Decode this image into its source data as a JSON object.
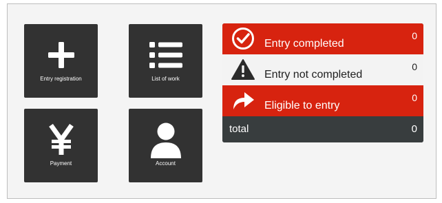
{
  "tiles": {
    "entry_registration": {
      "label": "Entry registration",
      "icon": "plus-icon"
    },
    "list_of_work": {
      "label": "List of work",
      "icon": "list-icon"
    },
    "payment": {
      "label": "Payment",
      "icon": "yen-icon"
    },
    "account": {
      "label": "Account",
      "icon": "user-icon"
    }
  },
  "status": {
    "completed": {
      "label": "Entry completed",
      "count": "0",
      "icon": "check-circle-icon"
    },
    "not_completed": {
      "label": "Entry not completed",
      "count": "0",
      "icon": "warning-icon"
    },
    "eligible": {
      "label": "Eligible to entry",
      "count": "0",
      "icon": "share-arrow-icon"
    },
    "total": {
      "label": "total",
      "count": "0"
    }
  },
  "colors": {
    "tile_bg": "#323232",
    "accent_red": "#d7230f",
    "total_bg": "#383d3e",
    "neutral_row": "#f3f3f3"
  }
}
